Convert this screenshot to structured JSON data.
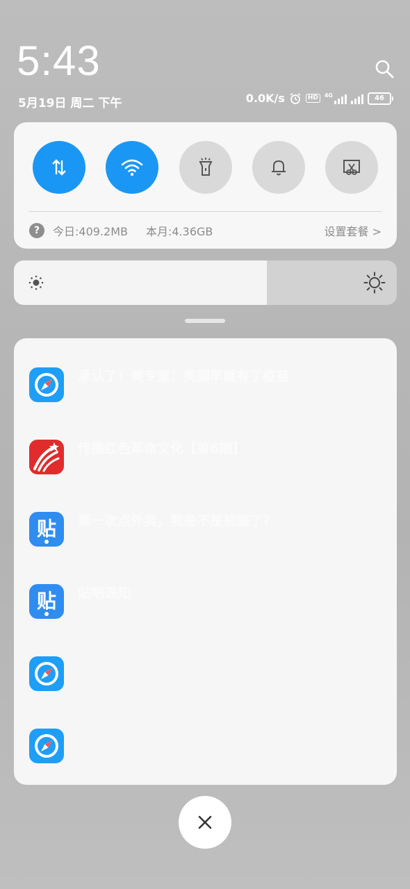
{
  "status": {
    "time": "5:43",
    "date": "5月19日 周二 下午",
    "net_speed": "0.0K/s",
    "hd_label": "HD",
    "network_label": "4G",
    "battery": "46"
  },
  "quick_settings": {
    "tiles": [
      {
        "name": "mobile-data",
        "icon": "data-transfer-icon",
        "active": true
      },
      {
        "name": "wifi",
        "icon": "wifi-icon",
        "active": true
      },
      {
        "name": "flashlight",
        "icon": "flashlight-icon",
        "active": false
      },
      {
        "name": "sound",
        "icon": "bell-icon",
        "active": false
      },
      {
        "name": "screenshot",
        "icon": "screenshot-icon",
        "active": false
      }
    ],
    "data_usage": {
      "today": "今日:409.2MB",
      "month": "本月:4.36GB",
      "plan_link": "设置套餐 >"
    }
  },
  "brightness": {
    "level": 0.66
  },
  "notifications": [
    {
      "app_icon": "compass-browser-icon",
      "title": "承认了！美专家：美国早就有了疫苗",
      "subtitle": "",
      "time": ""
    },
    {
      "app_icon": "xuexi-app-icon",
      "title": "传播红色革命文化【第6期】",
      "subtitle": "",
      "time": ""
    },
    {
      "app_icon": "tieba-app-icon",
      "title": "第一次点外卖，我是不是被骗了？",
      "subtitle": "",
      "time": ""
    },
    {
      "app_icon": "tieba-app-icon",
      "title": "贴吧通知",
      "subtitle": "",
      "time": ""
    },
    {
      "app_icon": "compass-browser-icon",
      "title": "",
      "subtitle": "",
      "time": ""
    },
    {
      "app_icon": "compass-browser-icon",
      "title": "",
      "subtitle": "",
      "time": ""
    }
  ],
  "colors": {
    "accent": "#1a97f4",
    "tile_off": "#d9d9d9",
    "card": "#f7f7f7"
  }
}
